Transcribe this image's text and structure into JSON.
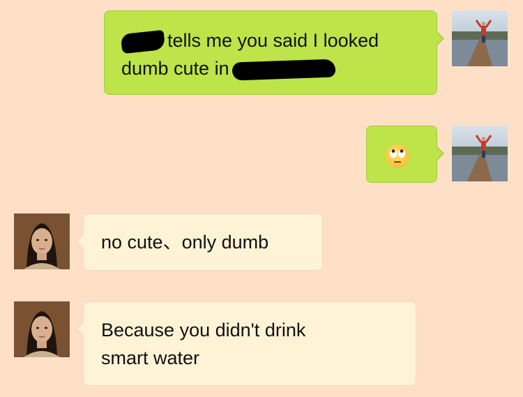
{
  "theme": {
    "background": "#ffe0c6",
    "sent_bubble": "#bde449",
    "received_bubble": "#fff3d6"
  },
  "messages": [
    {
      "direction": "sent",
      "line1_after_redaction": "tells me you said I looked",
      "line2_before_redaction": "dumb cute in",
      "avatar_icon": "pier-photo-avatar"
    },
    {
      "direction": "sent",
      "emoji": "face-with-rolling-eyes",
      "avatar_icon": "pier-photo-avatar"
    },
    {
      "direction": "received",
      "text": "no cute、only dumb",
      "avatar_icon": "woman-photo-avatar"
    },
    {
      "direction": "received",
      "line1": "Because you didn't drink",
      "line2": "smart water",
      "avatar_icon": "woman-photo-avatar"
    }
  ]
}
